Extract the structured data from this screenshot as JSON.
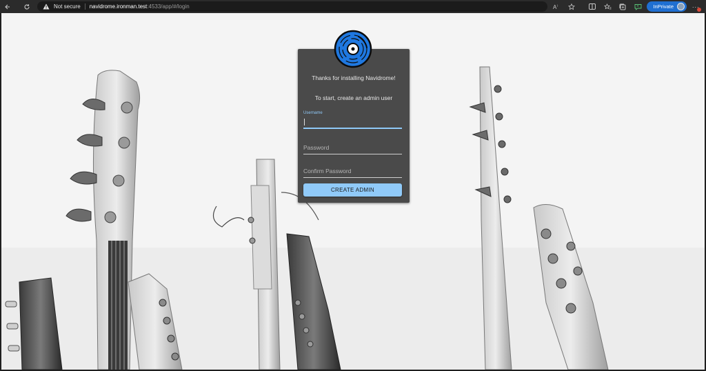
{
  "browser": {
    "security_label": "Not secure",
    "url_host": "navidrome.ironman.test",
    "url_rest": ":4533/app/#/login",
    "inprivate_label": "InPrivate",
    "icons": [
      "back-icon",
      "refresh-icon",
      "warning-icon",
      "read-aloud-icon",
      "favorite-icon",
      "split-screen-icon",
      "favorites-icon",
      "collections-icon",
      "feedback-icon",
      "more-icon"
    ]
  },
  "login": {
    "welcome": "Thanks for installing Navidrome!",
    "instruction": "To start, create an admin user",
    "username_label": "Username",
    "username_value": "",
    "password_placeholder": "Password",
    "confirm_password_placeholder": "Confirm Password",
    "submit_label": "CREATE ADMIN",
    "logo_icon": "vinyl-record-icon"
  },
  "colors": {
    "card_bg": "#4a4a4a",
    "accent": "#90caf9",
    "logo_blue": "#1f78e0",
    "page_bg": "#f3f3f3"
  }
}
